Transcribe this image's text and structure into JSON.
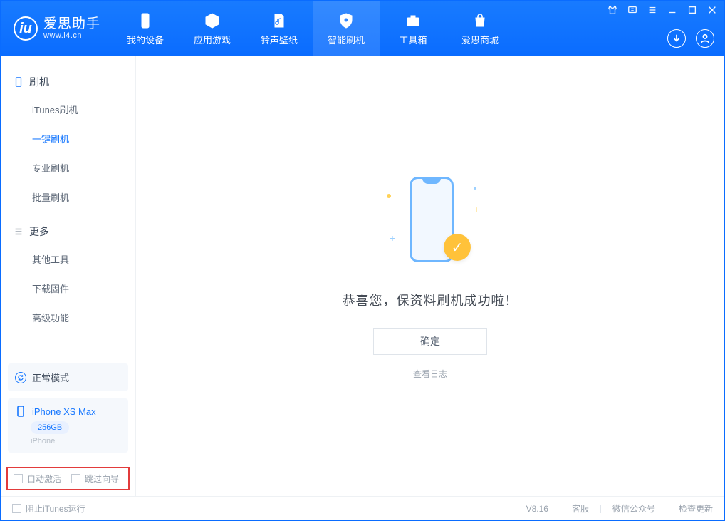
{
  "app": {
    "title": "爱思助手",
    "subtitle": "www.i4.cn"
  },
  "nav": {
    "device": "我的设备",
    "apps": "应用游戏",
    "ringtone": "铃声壁纸",
    "flash": "智能刷机",
    "toolbox": "工具箱",
    "store": "爱思商城"
  },
  "sidebar": {
    "group_flash": "刷机",
    "itunes_flash": "iTunes刷机",
    "one_click_flash": "一键刷机",
    "pro_flash": "专业刷机",
    "batch_flash": "批量刷机",
    "group_more": "更多",
    "other_tools": "其他工具",
    "download_fw": "下载固件",
    "advanced": "高级功能"
  },
  "mode": {
    "label": "正常模式"
  },
  "device": {
    "name": "iPhone XS Max",
    "capacity": "256GB",
    "type": "iPhone"
  },
  "options": {
    "auto_activate": "自动激活",
    "skip_guide": "跳过向导"
  },
  "main": {
    "success_msg": "恭喜您，保资料刷机成功啦！",
    "ok": "确定",
    "view_log": "查看日志"
  },
  "footer": {
    "block_itunes": "阻止iTunes运行",
    "version": "V8.16",
    "support": "客服",
    "wechat": "微信公众号",
    "check_update": "检查更新"
  }
}
